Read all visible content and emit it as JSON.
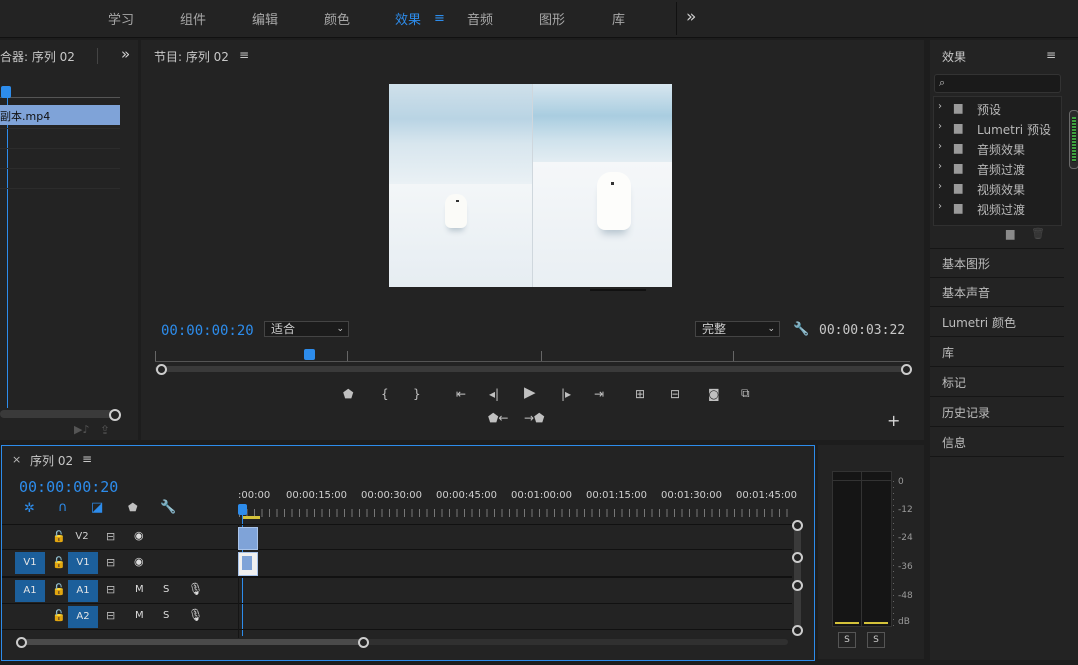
{
  "workspaces": [
    "学习",
    "组件",
    "编辑",
    "颜色",
    "效果",
    "音频",
    "图形",
    "库"
  ],
  "active_workspace": "效果",
  "more_glyph": "»",
  "source_panel": {
    "title": "合器: 序列 02",
    "clip_label": "副本.mp4"
  },
  "program_monitor": {
    "title": "节目: 序列 02",
    "timecode": "00:00:00:20",
    "fit": "适合",
    "quality": "完整",
    "duration": "00:00:03:22"
  },
  "effects_panel": {
    "title": "效果",
    "search_placeholder": "",
    "folders": [
      "预设",
      "Lumetri 预设",
      "音频效果",
      "音频过渡",
      "视频效果",
      "视频过渡"
    ]
  },
  "side_panels": [
    "基本图形",
    "基本声音",
    "Lumetri 颜色",
    "库",
    "标记",
    "历史记录",
    "信息"
  ],
  "timeline": {
    "title": "序列 02",
    "timecode": "00:00:00:20",
    "ruler": [
      ":00:00",
      "00:00:15:00",
      "00:00:30:00",
      "00:00:45:00",
      "00:01:00:00",
      "00:01:15:00",
      "00:01:30:00",
      "00:01:45:00"
    ],
    "tracks": {
      "v2": "V2",
      "v1_src": "V1",
      "v1": "V1",
      "a1_src": "A1",
      "a1": "A1",
      "a2": "A2",
      "m": "M",
      "s": "S"
    }
  },
  "meter": {
    "labels": [
      "0",
      "-12",
      "-24",
      "-36",
      "-48",
      "dB"
    ],
    "solo": [
      "S",
      "S"
    ]
  },
  "colors": {
    "accent": "#2d8ceb",
    "clip_blue": "#7fa3d8",
    "track_blue": "#1c5f9b"
  }
}
